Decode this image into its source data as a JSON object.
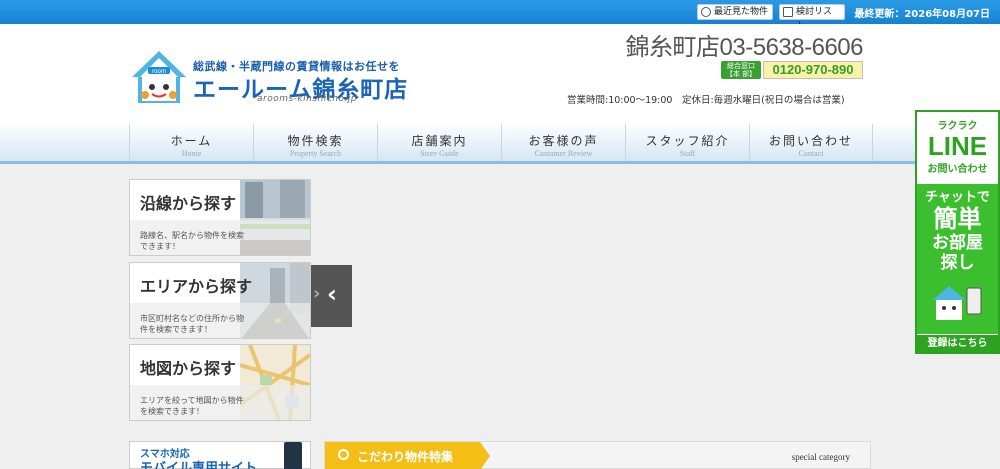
{
  "topbar": {
    "recent_label": "最近見た物件",
    "consider_label": "検討リスト",
    "last_updated": "最終更新：2026年08月07日"
  },
  "header": {
    "logo_small": "room",
    "tagline": "総武線・半蔵門線の賃貸情報はお任せを",
    "shop_name": "エールーム錦糸町店",
    "domain": "arooms-kinshicho.jp",
    "tel": "錦糸町店03-5638-6606",
    "free_badge": "総合窓口【本 部】",
    "free_dial": "0120-970-890",
    "hours": "営業時間:10:00〜19:00　定休日:毎週水曜日(祝日の場合は営業)"
  },
  "nav": {
    "items": [
      {
        "jp": "ホーム",
        "en": "Home"
      },
      {
        "jp": "物件検索",
        "en": "Property Search"
      },
      {
        "jp": "店舗案内",
        "en": "Store Guide"
      },
      {
        "jp": "お客様の声",
        "en": "Customer Review"
      },
      {
        "jp": "スタッフ紹介",
        "en": "Staff"
      },
      {
        "jp": "お問い合わせ",
        "en": "Contact"
      }
    ]
  },
  "search": {
    "line": {
      "title": "沿線から探す",
      "desc": "路線名、駅名から物件を検索できます！"
    },
    "area": {
      "title": "エリアから探す",
      "desc": "市区町村名などの住所から物件を検索できます！"
    },
    "map": {
      "title": "地図から探す",
      "desc": "エリアを絞って地図から物件を検索できます！"
    }
  },
  "slider": {
    "prev_arrow": "‹"
  },
  "mobile": {
    "line1": "スマホ対応",
    "line2": "モバイル専用サイト"
  },
  "special": {
    "label": "こだわり物件特集",
    "en": "special category"
  },
  "line_banner": {
    "raku": "ラクラク",
    "line": "LINE",
    "otoiawase": "お問い合わせ",
    "chat": "チャットで",
    "kantan": "簡単",
    "heya": "お部屋",
    "sagashi": "探し",
    "register": "登録はこちら"
  }
}
